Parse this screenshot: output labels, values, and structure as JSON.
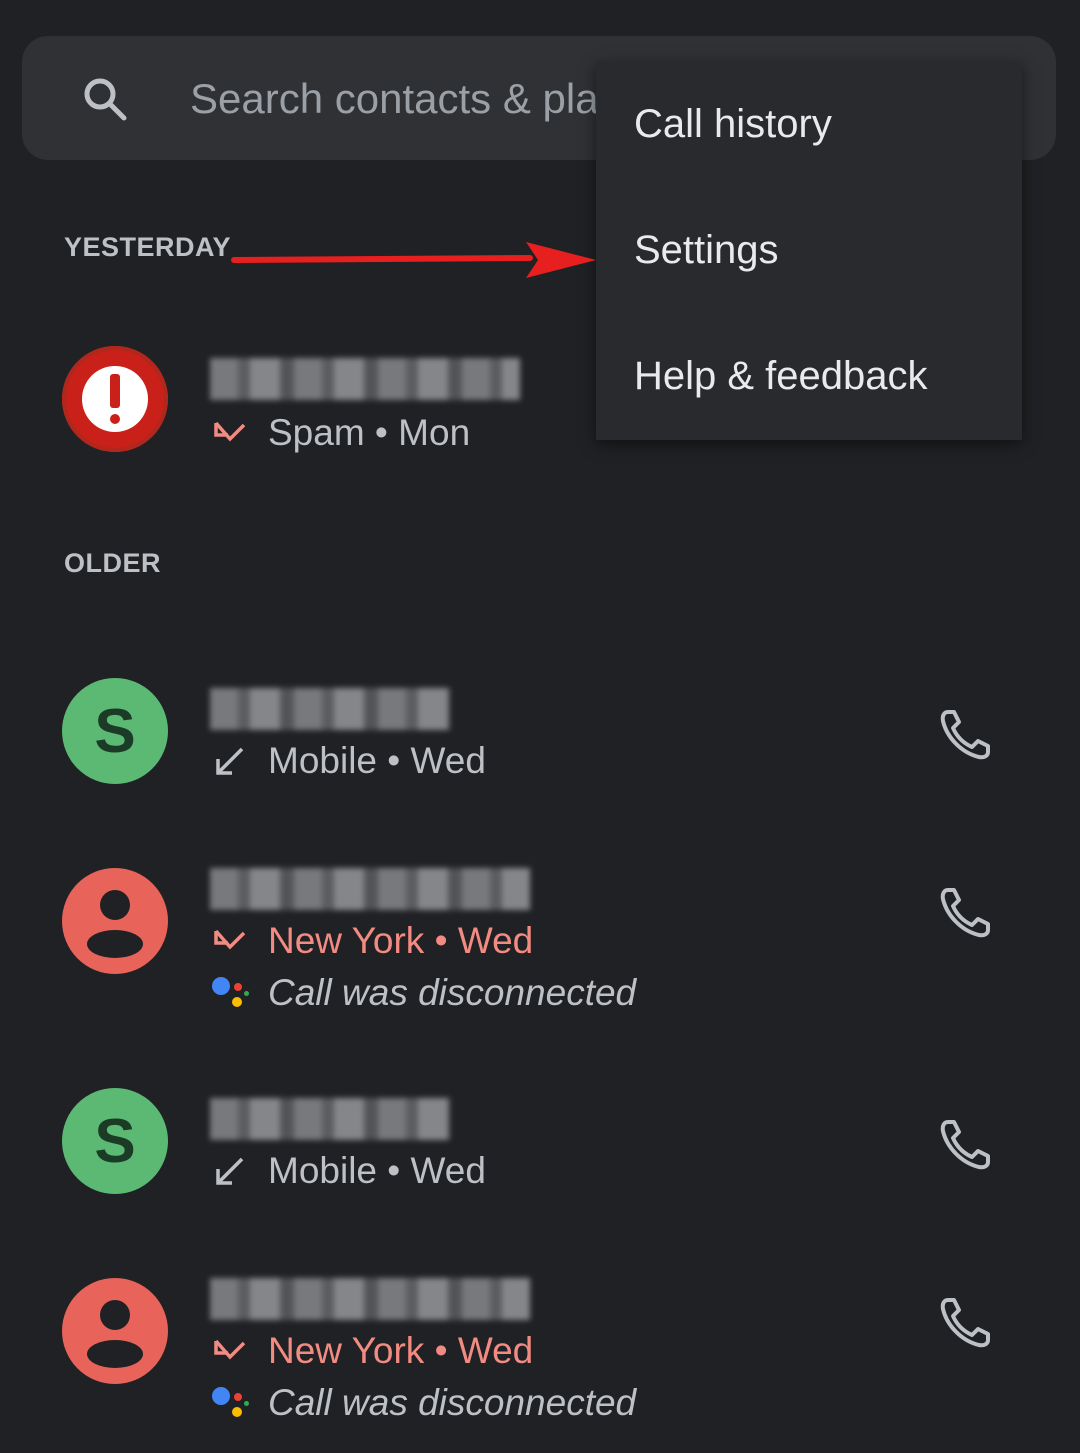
{
  "search": {
    "placeholder": "Search contacts & pla",
    "icon": "search-icon"
  },
  "menu": {
    "items": [
      {
        "label": "Call history"
      },
      {
        "label": "Settings"
      },
      {
        "label": "Help & feedback"
      }
    ]
  },
  "sections": {
    "yesterday": "YESTERDAY",
    "older": "OLDER"
  },
  "calls": [
    {
      "avatar": "spam",
      "call_type": "missed",
      "detail": "Spam • Mon"
    },
    {
      "avatar": "green",
      "call_type": "outgoing",
      "detail": "Mobile • Wed"
    },
    {
      "avatar": "person",
      "call_type": "missed",
      "detail": "New York • Wed",
      "note": "Call was disconnected"
    },
    {
      "avatar": "green",
      "call_type": "outgoing",
      "detail": "Mobile • Wed"
    },
    {
      "avatar": "person",
      "call_type": "missed",
      "detail": "New York • Wed",
      "note": "Call was disconnected"
    }
  ],
  "colors": {
    "background": "#202124",
    "missed": "#f28b82",
    "annotation_arrow": "#e81f1f",
    "person_avatar": "#e8635a",
    "green_avatar": "#5bb974",
    "spam_avatar": "#c9201a"
  }
}
